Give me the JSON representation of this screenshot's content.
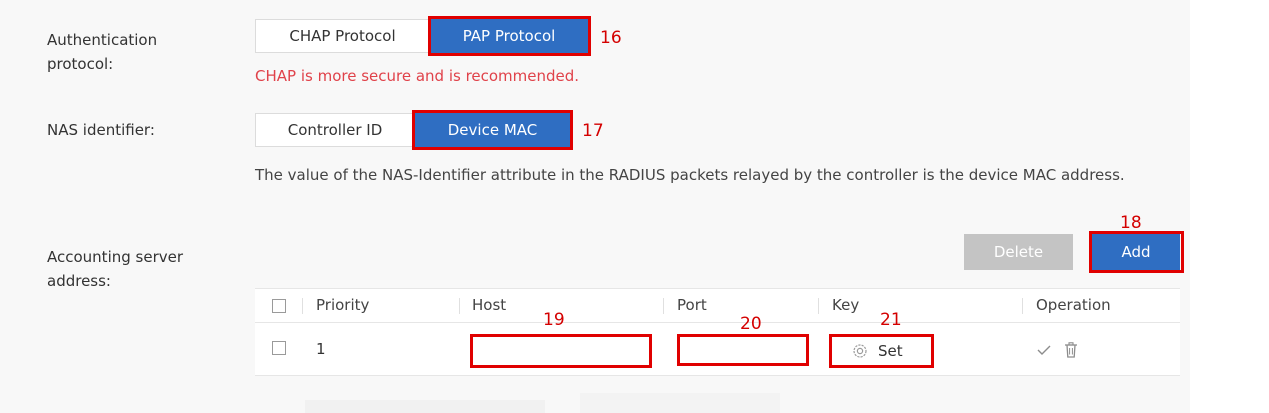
{
  "auth": {
    "label": "Authentication protocol:",
    "options": [
      "CHAP Protocol",
      "PAP Protocol"
    ],
    "selected": "PAP Protocol",
    "hint": "CHAP is more secure and is recommended."
  },
  "nas": {
    "label": "NAS identifier:",
    "options": [
      "Controller ID",
      "Device MAC"
    ],
    "selected": "Device MAC",
    "description": "The value of the NAS-Identifier attribute in the RADIUS packets relayed by the controller is the device MAC address."
  },
  "accounting": {
    "label": "Accounting server address:",
    "delete_label": "Delete",
    "add_label": "Add",
    "columns": [
      "Priority",
      "Host",
      "Port",
      "Key",
      "Operation"
    ],
    "rows": [
      {
        "priority": "1",
        "host": "",
        "port": "",
        "key_label": "Set"
      }
    ]
  },
  "markers": [
    "16",
    "17",
    "18",
    "19",
    "20",
    "21"
  ],
  "colors": {
    "accent": "#2f6ec2",
    "highlight": "#e00000",
    "hint": "#e0424a",
    "disabled": "#c4c4c4"
  },
  "icons": [
    "gear-icon",
    "check-icon",
    "trash-icon",
    "checkbox-icon"
  ]
}
